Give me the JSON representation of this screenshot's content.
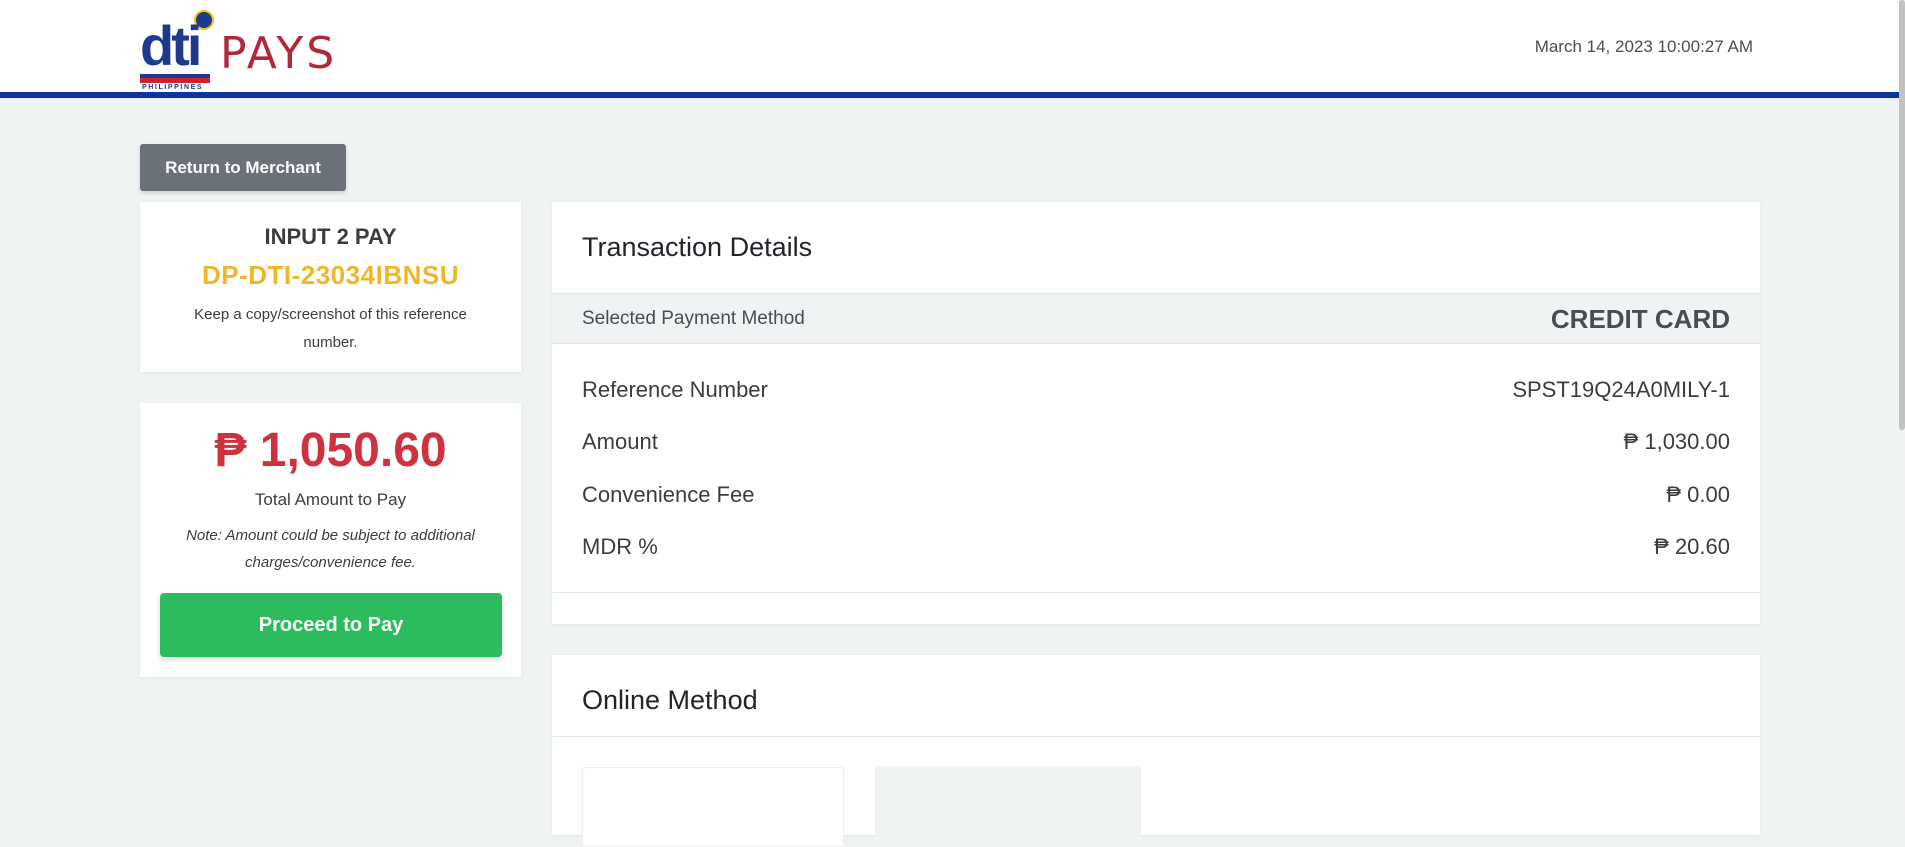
{
  "header": {
    "logo": {
      "brand_dti": "dti",
      "brand_pays": "PAYS",
      "country": "PHILIPPINES"
    },
    "datetime": "March 14, 2023 10:00:27 AM"
  },
  "actions": {
    "return_label": "Return to Merchant"
  },
  "reference_card": {
    "title": "INPUT 2 PAY",
    "reference": "DP-DTI-23034IBNSU",
    "hint": "Keep a copy/screenshot of this reference number."
  },
  "total_card": {
    "amount": "₱ 1,050.60",
    "label": "Total Amount to Pay",
    "note": "Note: Amount could be subject to additional charges/convenience fee.",
    "pay_label": "Proceed to Pay"
  },
  "transaction": {
    "title": "Transaction Details",
    "payment_method_label": "Selected Payment Method",
    "payment_method_value": "CREDIT CARD",
    "rows": [
      {
        "label": "Reference Number",
        "value": "SPST19Q24A0MILY-1"
      },
      {
        "label": "Amount",
        "value": "₱ 1,030.00"
      },
      {
        "label": "Convenience Fee",
        "value": "₱ 0.00"
      },
      {
        "label": "MDR %",
        "value": "₱ 20.60"
      }
    ]
  },
  "online": {
    "title": "Online Method"
  },
  "colors": {
    "header_border": "#0b34a0",
    "reference": "#f1b52a",
    "amount": "#d0313f",
    "pay_button": "#2cbb5d",
    "return_button": "#6b7178"
  }
}
